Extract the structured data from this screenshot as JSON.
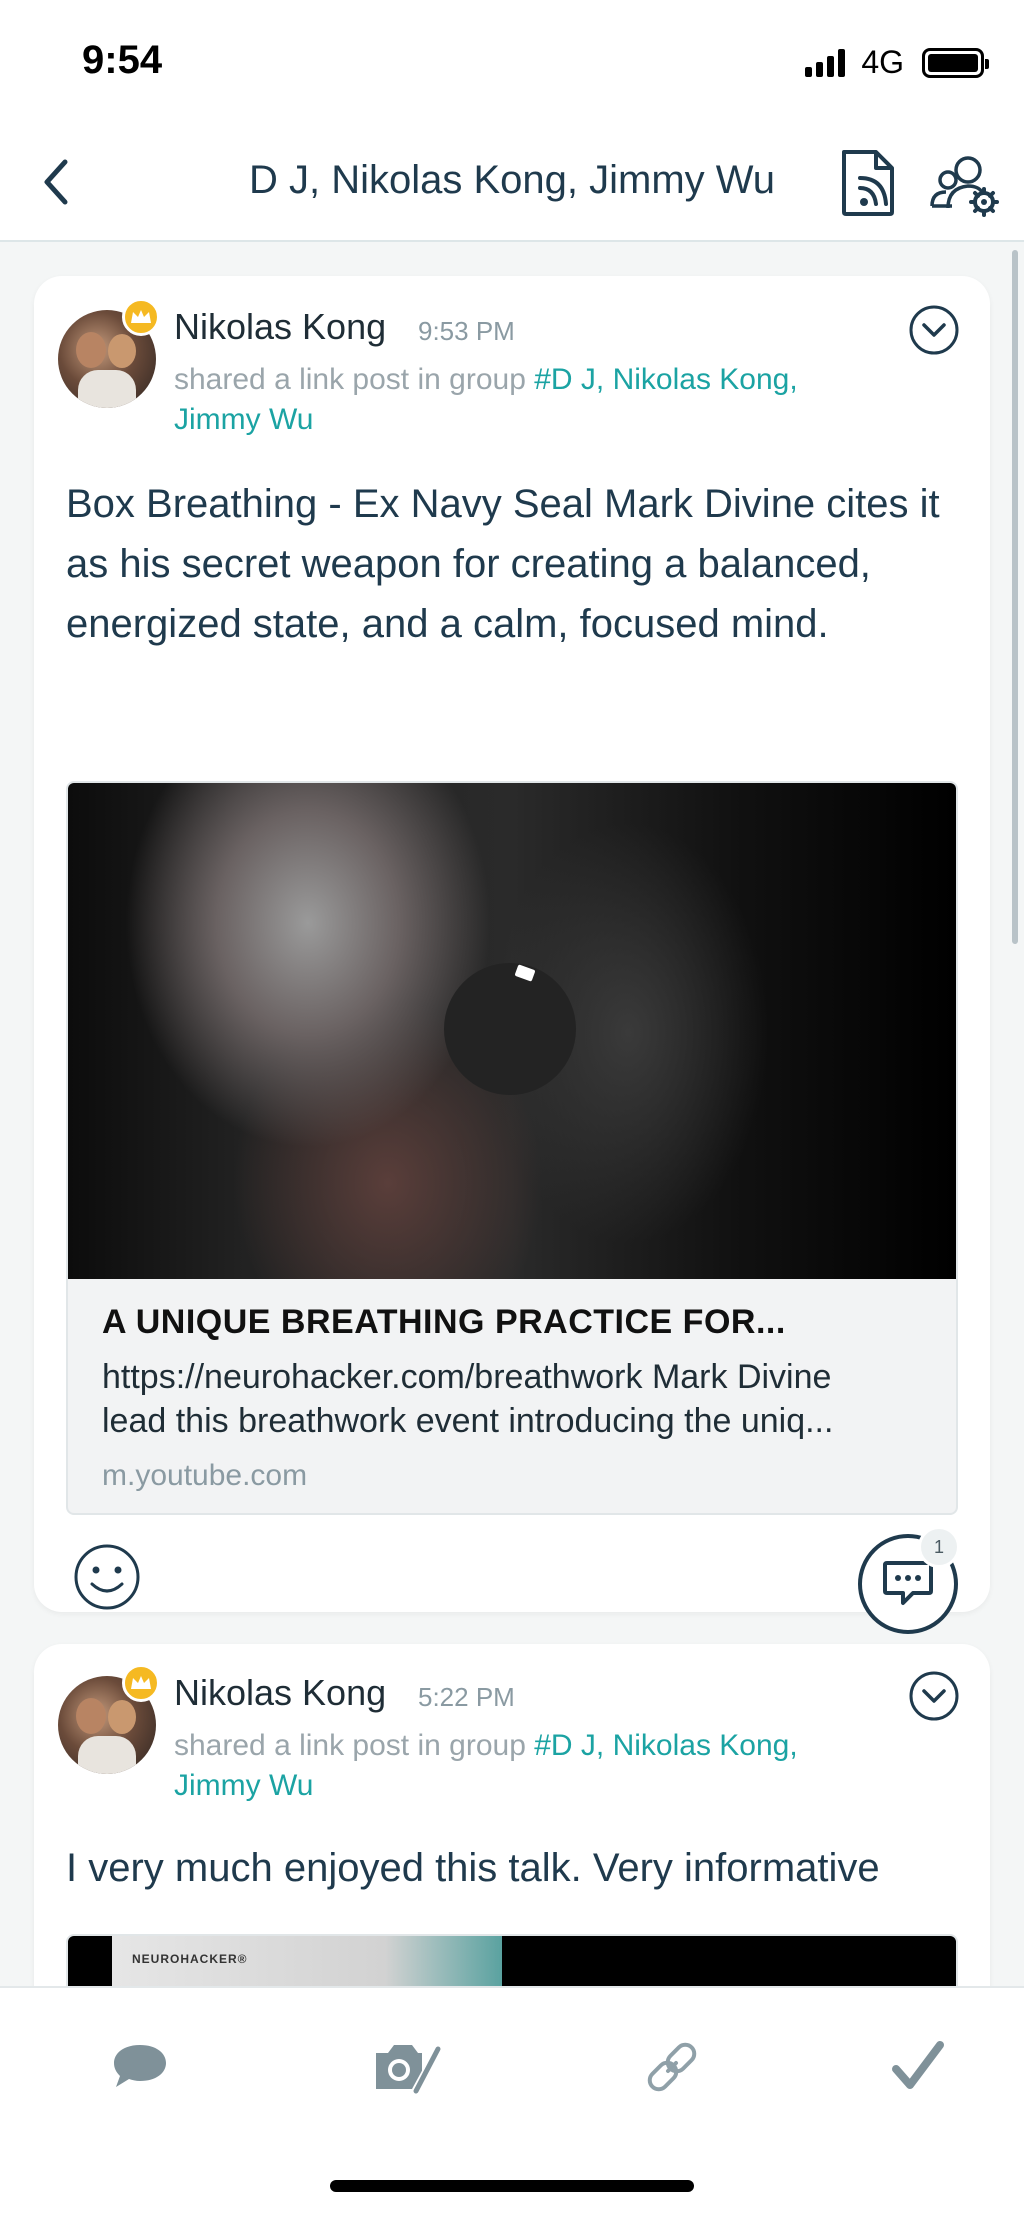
{
  "status_bar": {
    "time": "9:54",
    "network": "4G"
  },
  "header": {
    "title": "D J, Nikolas Kong, Jimmy Wu"
  },
  "posts": [
    {
      "author": "Nikolas Kong",
      "time": "9:53 PM",
      "shared_prefix": "shared a link post in group",
      "group": "#D J, Nikolas Kong, Jimmy Wu",
      "text": "Box Breathing - Ex Navy Seal Mark Divine cites it as his secret weapon for creating a balanced, energized state, and a calm, focused mind.",
      "link": {
        "title": "A UNIQUE BREATHING PRACTICE FOR...",
        "desc_line1": "https://neurohacker.com/breathwork Mark Divine",
        "desc_line2": "lead this breathwork event introducing the uniq...",
        "domain": "m.youtube.com"
      },
      "comment_count": "1"
    },
    {
      "author": "Nikolas Kong",
      "time": "5:22 PM",
      "shared_prefix": "shared a link post in group",
      "group": "#D J, Nikolas Kong, Jimmy Wu",
      "text": "I very much enjoyed this talk. Very informative",
      "thumb_logo": "NEUROHACKER®"
    }
  ],
  "toolbar": {
    "items": [
      "chat-icon",
      "camera-edit-icon",
      "link-icon",
      "check-icon"
    ]
  },
  "colors": {
    "accent": "#1ba3a3",
    "primary_text": "#1f3a4d",
    "crown": "#f5b922"
  }
}
